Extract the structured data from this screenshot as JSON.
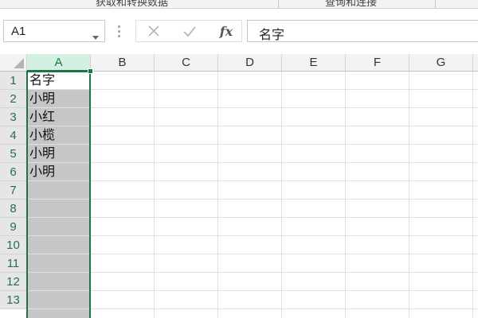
{
  "ribbon": {
    "group1_label": "获取和转换数据",
    "group2_label": "查询和连接"
  },
  "formula_bar": {
    "name_box": "A1",
    "cancel_icon": "close-icon",
    "enter_icon": "check-icon",
    "function_label": "fx",
    "content": "名字"
  },
  "sheet": {
    "columns": [
      "A",
      "B",
      "C",
      "D",
      "E",
      "F",
      "G"
    ],
    "selected_column": "A",
    "rows": [
      "1",
      "2",
      "3",
      "4",
      "5",
      "6",
      "7",
      "8",
      "9",
      "10",
      "11",
      "12",
      "13"
    ],
    "active_cell": "A1",
    "cells_col_a": [
      "名字",
      "小明",
      "小红",
      "小榄",
      "小明",
      "小明"
    ],
    "colors": {
      "selection": "#217346",
      "selected_fill": "#c6c6c6",
      "header_bg": "#f3f3f3",
      "selected_header_bg": "#d3f0e0"
    }
  }
}
